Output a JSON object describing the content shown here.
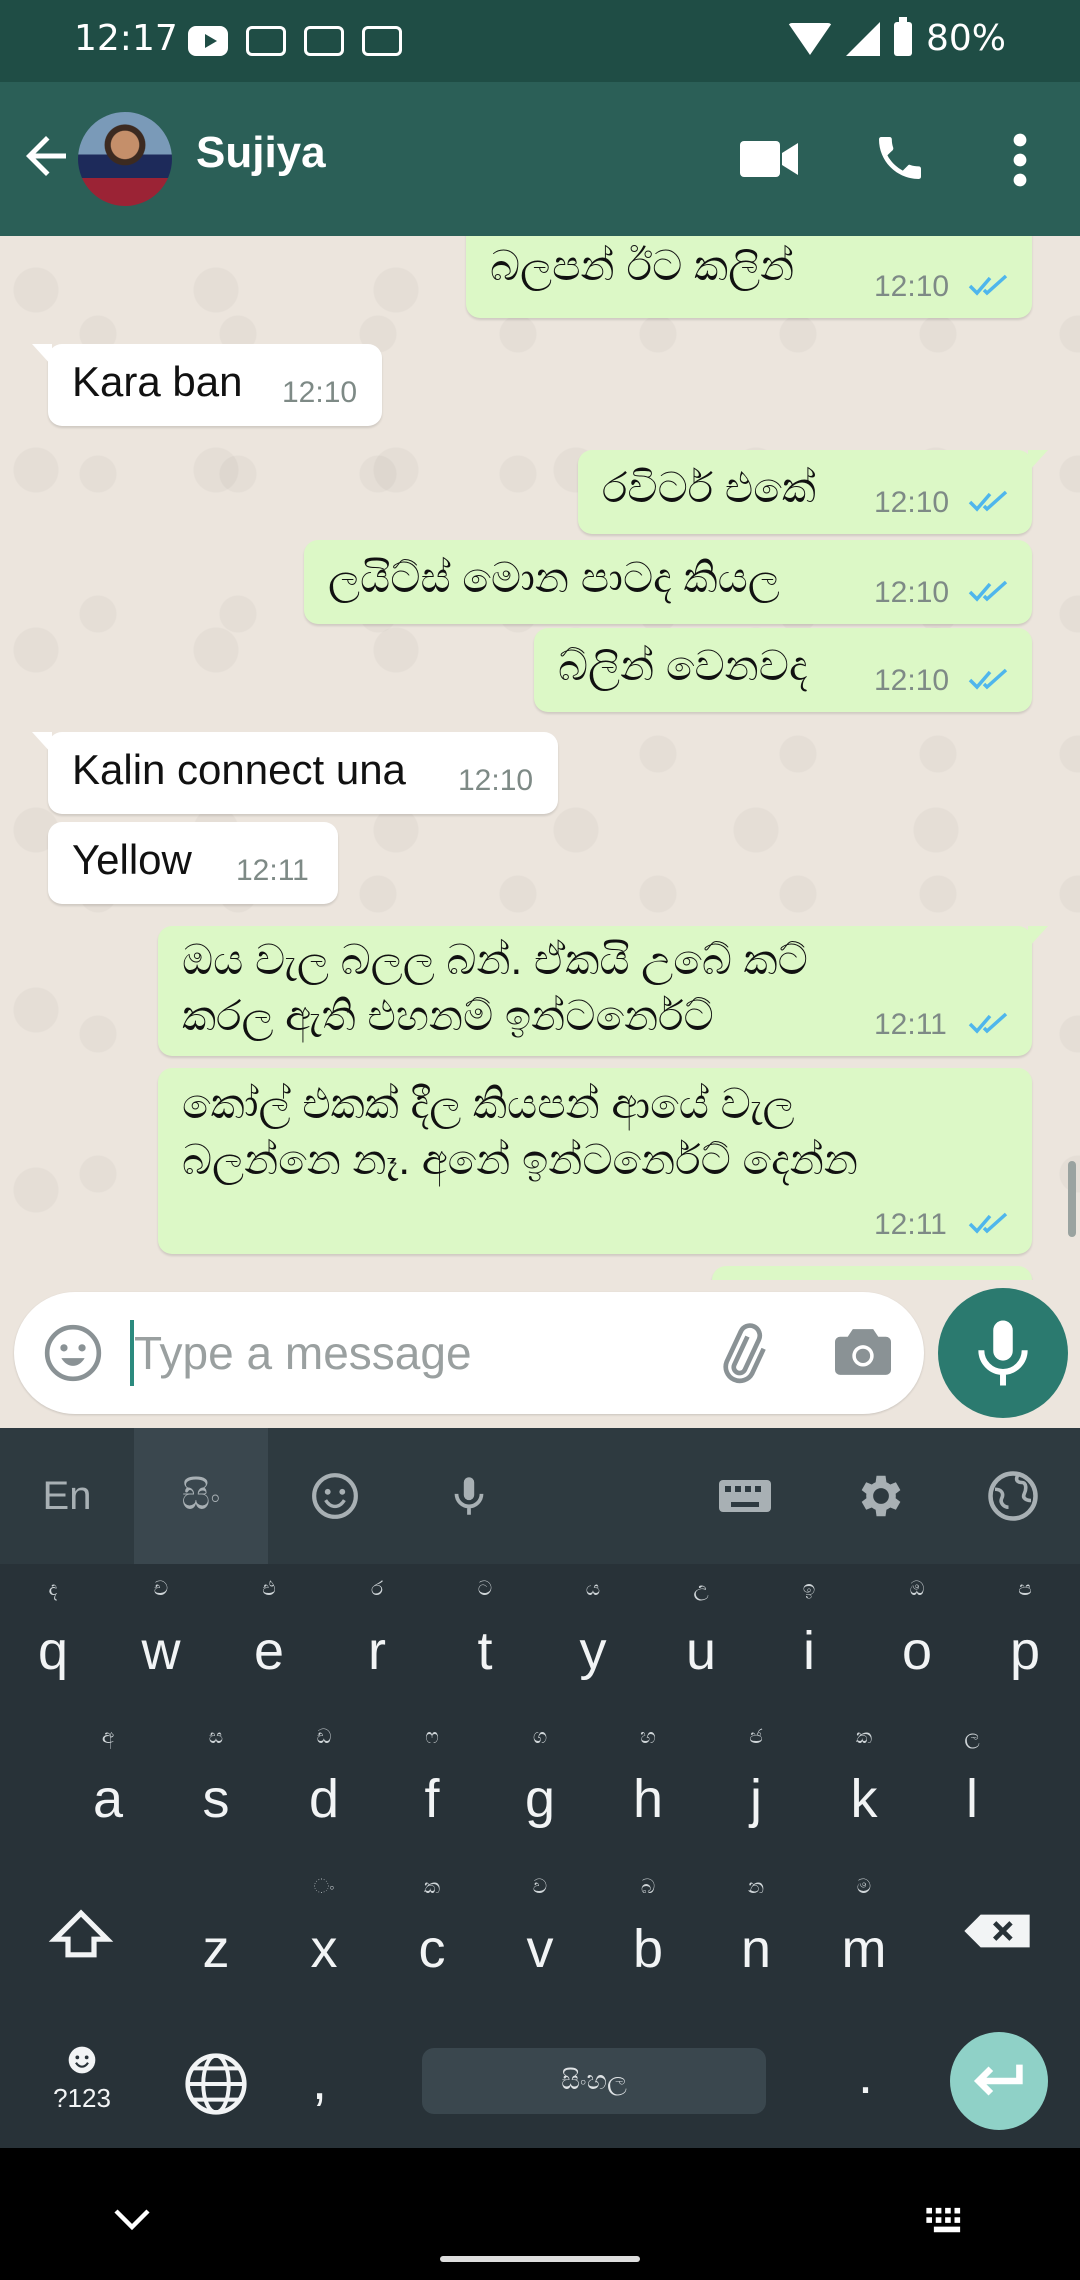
{
  "status_bar": {
    "time": "12:17",
    "battery": "80%",
    "icons": [
      "youtube-icon",
      "calendar-icon",
      "gmail-icon",
      "gmail-icon",
      "wifi-icon",
      "signal-icon",
      "battery-icon"
    ]
  },
  "header": {
    "contact_name": "Sujiya"
  },
  "messages": [
    {
      "dir": "out",
      "text": "බලපන් ඊට කලින්",
      "time": "12:10",
      "status": "read"
    },
    {
      "dir": "in",
      "text": "Kara ban",
      "time": "12:10"
    },
    {
      "dir": "out",
      "text": "රවිටර් එකේ",
      "time": "12:10",
      "status": "read"
    },
    {
      "dir": "out",
      "text": "ලයිට්ස් මොන පාටද කියල",
      "time": "12:10",
      "status": "read"
    },
    {
      "dir": "out",
      "text": "බ්ලින් වෙනවද",
      "time": "12:10",
      "status": "read"
    },
    {
      "dir": "in",
      "text": "Kalin connect una",
      "time": "12:10"
    },
    {
      "dir": "in",
      "text": "Yellow",
      "time": "12:11"
    },
    {
      "dir": "out",
      "line1": "ඔය වැල බලල බන්. ඒකයි උබේ කට්",
      "line2": "කරල ඇති එහනම් ඉන්ටර්නෙට්",
      "time": "12:11",
      "status": "read"
    },
    {
      "dir": "out",
      "line1": "කෝල් එකක් දීල කියපන් ආයේ වැල",
      "line2": "බලන්නෙ නෑ. අනේ ඉන්ටර්නෙට්  දෙන්න",
      "time": "12:11",
      "status": "read"
    }
  ],
  "composer": {
    "placeholder": "Type a message"
  },
  "keyboard": {
    "toolbar": {
      "lang_en": "En",
      "lang_si": "සිං"
    },
    "row1": [
      {
        "k": "q",
        "h": "ද"
      },
      {
        "k": "w",
        "h": "ච"
      },
      {
        "k": "e",
        "h": "එ"
      },
      {
        "k": "r",
        "h": "ර"
      },
      {
        "k": "t",
        "h": "ට"
      },
      {
        "k": "y",
        "h": "ය"
      },
      {
        "k": "u",
        "h": "උ"
      },
      {
        "k": "i",
        "h": "ඉ"
      },
      {
        "k": "o",
        "h": "ඔ"
      },
      {
        "k": "p",
        "h": "ප"
      }
    ],
    "row2": [
      {
        "k": "a",
        "h": "අ"
      },
      {
        "k": "s",
        "h": "ස"
      },
      {
        "k": "d",
        "h": "ඩ"
      },
      {
        "k": "f",
        "h": "ෆ"
      },
      {
        "k": "g",
        "h": "ග"
      },
      {
        "k": "h",
        "h": "හ"
      },
      {
        "k": "j",
        "h": "ජ"
      },
      {
        "k": "k",
        "h": "ක"
      },
      {
        "k": "l",
        "h": "ල"
      }
    ],
    "row3": [
      {
        "k": "z",
        "h": ""
      },
      {
        "k": "x",
        "h": "ං"
      },
      {
        "k": "c",
        "h": "ක"
      },
      {
        "k": "v",
        "h": "ව"
      },
      {
        "k": "b",
        "h": "බ"
      },
      {
        "k": "n",
        "h": "න"
      },
      {
        "k": "m",
        "h": "ම"
      }
    ],
    "symbols_label": "?123",
    "comma": ",",
    "period": ".",
    "space_label": "සිංහල"
  }
}
